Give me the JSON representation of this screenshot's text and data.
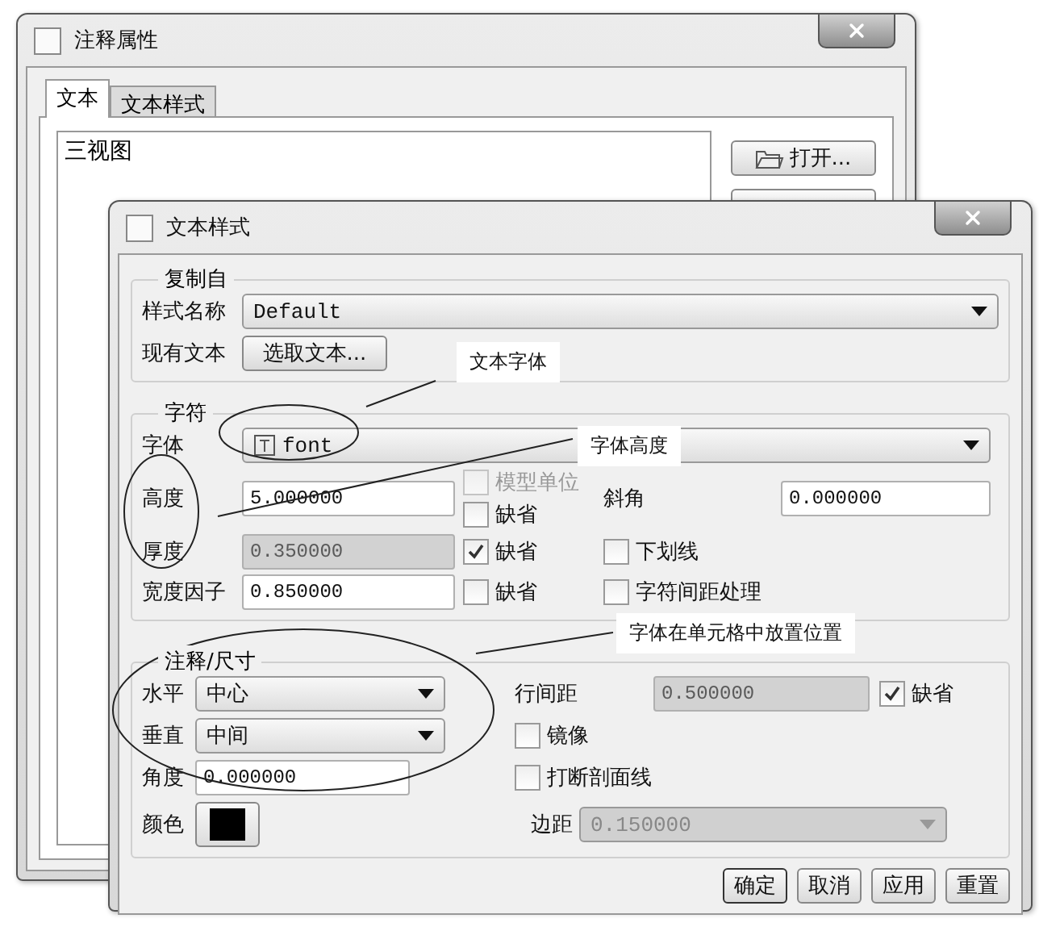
{
  "back_window": {
    "title": "注释属性",
    "tabs": [
      {
        "label": "文本",
        "selected": true
      },
      {
        "label": "文本样式",
        "selected": false
      }
    ],
    "text": "三视图",
    "open_button": "打开..."
  },
  "front_window": {
    "title": "文本样式",
    "copy_from": {
      "legend": "复制自",
      "style_name_label": "样式名称",
      "style_name": "Default",
      "existing_text_label": "现有文本",
      "pick_text_button": "选取文本..."
    },
    "character": {
      "legend": "字符",
      "font_label": "字体",
      "font": "font",
      "height_label": "高度",
      "height": {
        "value": "5.000000",
        "disabled": false
      },
      "model_units": {
        "label": "模型单位",
        "checked": false,
        "disabled": true
      },
      "height_default": {
        "label": "缺省",
        "checked": false,
        "disabled": false
      },
      "slant_label": "斜角",
      "slant": {
        "value": "0.000000",
        "disabled": false
      },
      "thickness_label": "厚度",
      "thickness": {
        "value": "0.350000",
        "disabled": true
      },
      "thickness_default": {
        "label": "缺省",
        "checked": true,
        "disabled": false
      },
      "underline": {
        "label": "下划线",
        "checked": false,
        "disabled": false
      },
      "width_factor_label": "宽度因子",
      "width_factor": {
        "value": "0.850000",
        "disabled": false
      },
      "width_default": {
        "label": "缺省",
        "checked": false,
        "disabled": false
      },
      "kerning": {
        "label": "字符间距处理",
        "checked": false,
        "disabled": false
      }
    },
    "note_dimension": {
      "legend": "注释/尺寸",
      "horizontal_label": "水平",
      "horizontal": "中心",
      "vertical_label": "垂直",
      "vertical": "中间",
      "angle_label": "角度",
      "angle": {
        "value": "0.000000",
        "disabled": false
      },
      "color_label": "颜色",
      "color": "#000000",
      "line_spacing_label": "行间距",
      "line_spacing": {
        "value": "0.500000",
        "disabled": true
      },
      "line_spacing_default": {
        "label": "缺省",
        "checked": true,
        "disabled": false
      },
      "mirror": {
        "label": "镜像",
        "checked": false,
        "disabled": false
      },
      "break_hatch": {
        "label": "打断剖面线",
        "checked": false,
        "disabled": false
      },
      "margin_label": "边距",
      "margin": {
        "value": "0.150000",
        "disabled": true
      }
    },
    "buttons": [
      "确定",
      "取消",
      "应用",
      "重置"
    ]
  },
  "annotations": [
    {
      "text": "文本字体"
    },
    {
      "text": "字体高度"
    },
    {
      "text": "字体在单元格中放置位置"
    }
  ]
}
